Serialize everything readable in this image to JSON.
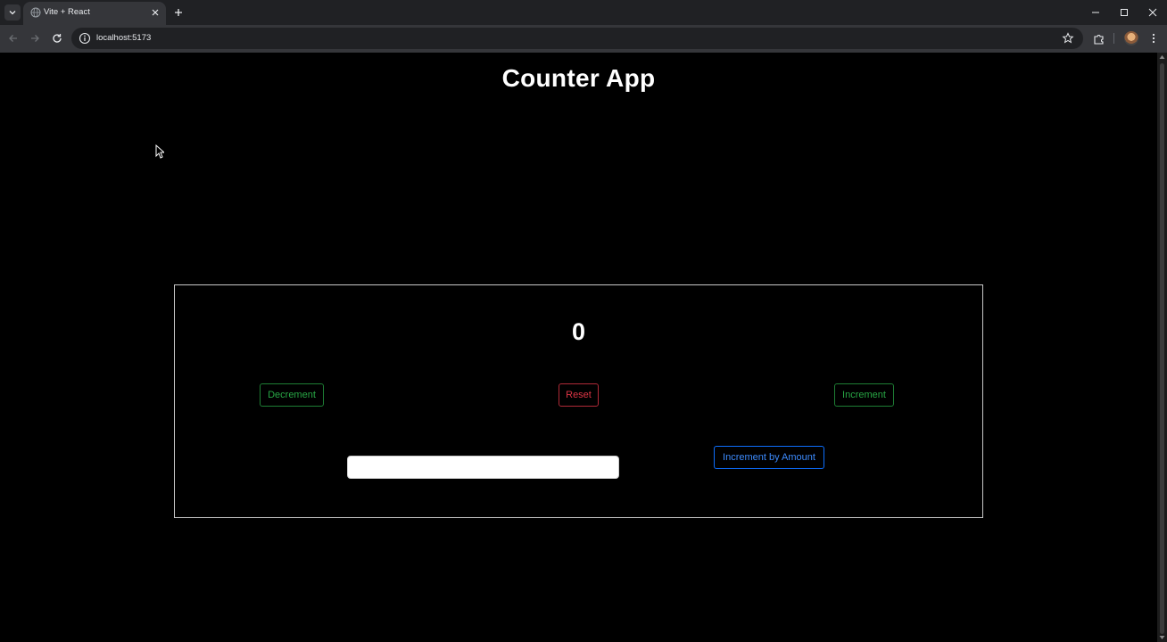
{
  "browser": {
    "tab_title": "Vite + React",
    "url": "localhost:5173"
  },
  "page": {
    "title": "Counter App",
    "count": "0",
    "buttons": {
      "decrement": "Decrement",
      "reset": "Reset",
      "increment": "Increment",
      "increment_by_amount": "Increment by Amount"
    },
    "amount_input": {
      "value": "",
      "placeholder": ""
    }
  },
  "colors": {
    "background": "#000000",
    "success": "#28a745",
    "danger": "#dc3545",
    "primary": "#0d6efd"
  }
}
